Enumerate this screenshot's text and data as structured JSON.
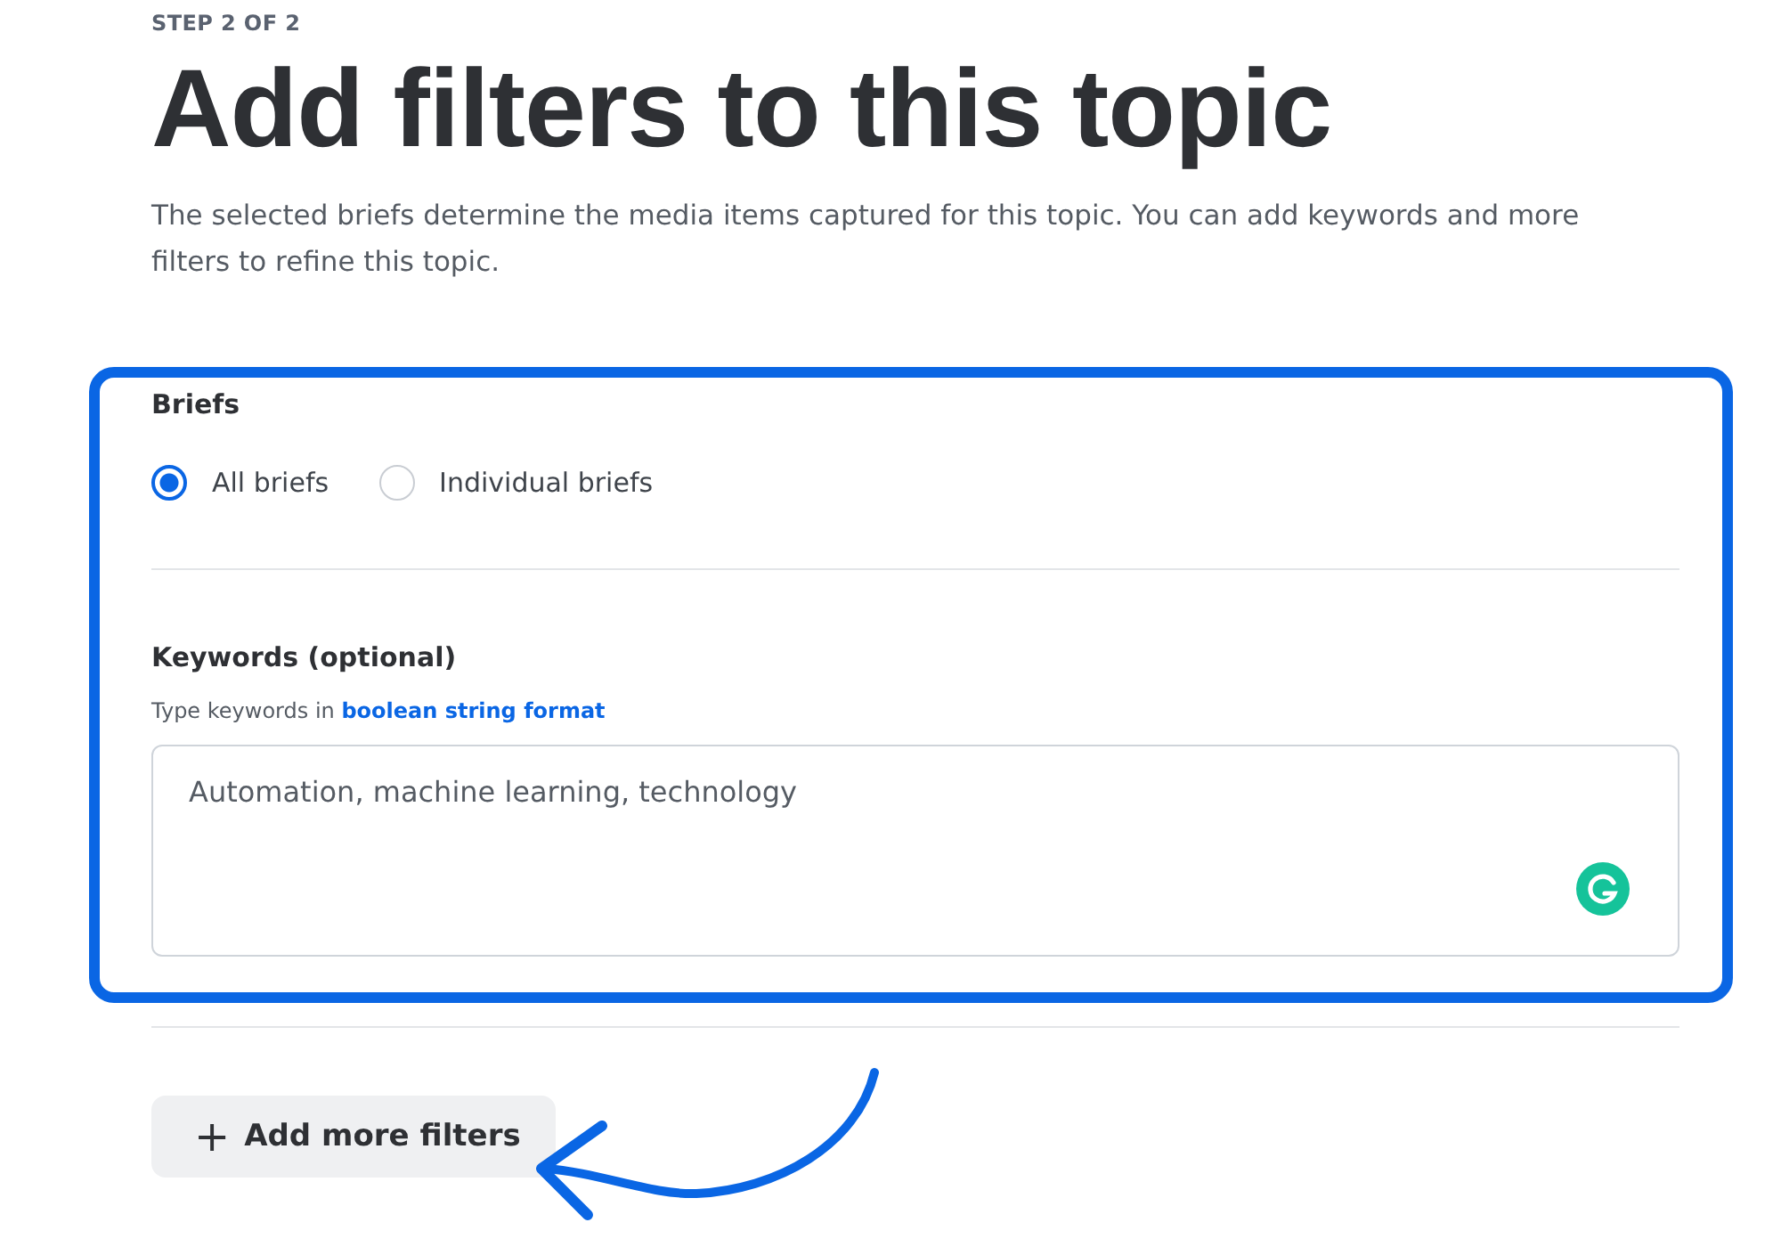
{
  "step": "STEP 2 OF 2",
  "title": "Add filters to this topic",
  "description": "The selected briefs determine the media items captured for this topic. You can add keywords and more filters to refine this topic.",
  "briefs": {
    "label": "Briefs",
    "options": [
      {
        "label": "All briefs",
        "selected": true
      },
      {
        "label": "Individual briefs",
        "selected": false
      }
    ]
  },
  "keywords": {
    "label": "Keywords (optional)",
    "hint": "Type keywords in",
    "hint_link": "boolean string format",
    "value": "Automation, machine learning, technology"
  },
  "add_button": {
    "icon": "+",
    "label": "Add more filters"
  }
}
